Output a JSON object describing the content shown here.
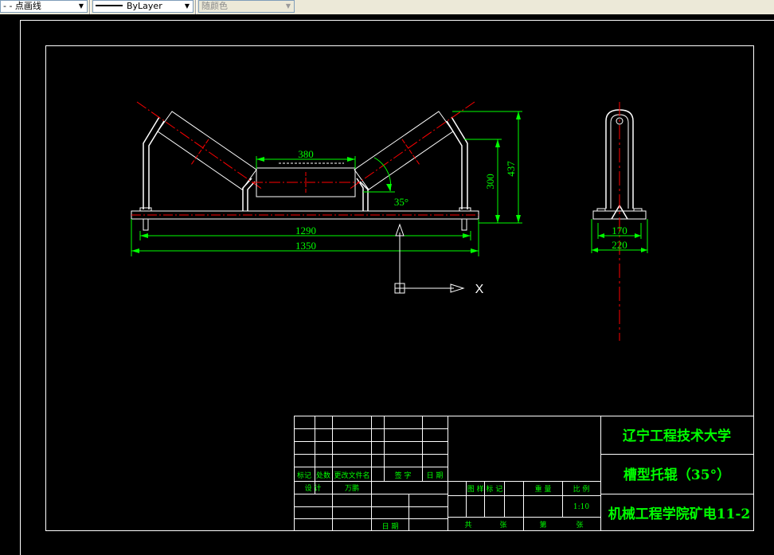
{
  "toolbar": {
    "linetype_value": "- - 点画线",
    "lineweight_value": "ByLayer",
    "color_value": "随颜色"
  },
  "drawing": {
    "dim_roller_length": "380",
    "dim_angle": "35°",
    "dim_height_300": "300",
    "dim_height_437": "437",
    "dim_width_1290": "1290",
    "dim_width_1350": "1350",
    "dim_side_170": "170",
    "dim_side_220": "220",
    "ucs_x_label": "X"
  },
  "title_block": {
    "school": "辽宁工程技术大学",
    "drawing_title": "槽型托辊（35°）",
    "department": "机械工程学院矿电11-2",
    "rev_marks": "标记",
    "rev_count": "处数",
    "rev_docno": "更改文件名",
    "rev_sign": "签 字",
    "rev_date": "日 期",
    "design_label": "设 计",
    "designer": "万鹏",
    "date_label": "日 期",
    "mark_label": "图 样 标 记",
    "weight_label": "重 量",
    "scale_label": "比 例",
    "scale_value": "1:10",
    "total_label": "共",
    "sheet_unit": "张",
    "sheet_label": "第",
    "sheet_unit2": "张"
  },
  "colors": {
    "background": "#000000",
    "frame": "#ffffff",
    "dimension": "#00ff00",
    "centerline": "#ff0000",
    "title_text": "#00ff00"
  }
}
